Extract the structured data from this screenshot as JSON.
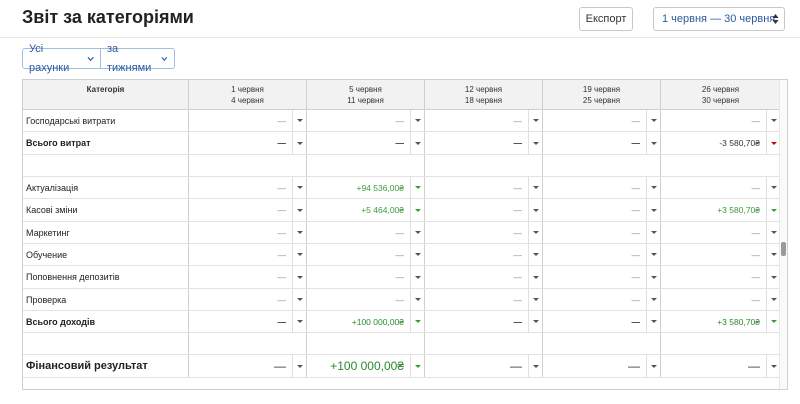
{
  "header": {
    "title": "Звіт за категоріями",
    "export_label": "Експорт",
    "date_range": "1 червня — 30 червня"
  },
  "filters": {
    "accounts": "Усі рахунки",
    "period": "за тижнями"
  },
  "table": {
    "category_header": "Категорія",
    "columns": [
      {
        "line1": "1 червня",
        "line2": "4 червня"
      },
      {
        "line1": "5 червня",
        "line2": "11 червня"
      },
      {
        "line1": "12 червня",
        "line2": "18 червня"
      },
      {
        "line1": "19 червня",
        "line2": "25 червня"
      },
      {
        "line1": "26 червня",
        "line2": "30 червня"
      }
    ],
    "rows": [
      {
        "label": "Господарські витрати",
        "style": "normal",
        "values": [
          "—",
          "—",
          "—",
          "—",
          "—"
        ],
        "tones": [
          "",
          "",
          "",
          "",
          ""
        ]
      },
      {
        "label": "Всього витрат",
        "style": "bold",
        "values": [
          "—",
          "—",
          "—",
          "—",
          "-3 580,70₴"
        ],
        "tones": [
          "",
          "",
          "",
          "",
          "neg"
        ]
      },
      {
        "label": "",
        "style": "empty",
        "values": [
          "",
          "",
          "",
          "",
          ""
        ],
        "tones": [
          "",
          "",
          "",
          "",
          ""
        ]
      },
      {
        "label": "Актуалізація",
        "style": "normal",
        "values": [
          "—",
          "+94 536,00₴",
          "—",
          "—",
          "—"
        ],
        "tones": [
          "",
          "pos",
          "",
          "",
          ""
        ]
      },
      {
        "label": "Касові зміни",
        "style": "normal",
        "values": [
          "—",
          "+5 464,00₴",
          "—",
          "—",
          "+3 580,70₴"
        ],
        "tones": [
          "",
          "pos",
          "",
          "",
          "pos"
        ]
      },
      {
        "label": "Маркетинг",
        "style": "normal",
        "values": [
          "—",
          "—",
          "—",
          "—",
          "—"
        ],
        "tones": [
          "",
          "",
          "",
          "",
          ""
        ]
      },
      {
        "label": "Обучение",
        "style": "normal",
        "values": [
          "—",
          "—",
          "—",
          "—",
          "—"
        ],
        "tones": [
          "",
          "",
          "",
          "",
          ""
        ]
      },
      {
        "label": "Поповнення депозитів",
        "style": "normal",
        "values": [
          "—",
          "—",
          "—",
          "—",
          "—"
        ],
        "tones": [
          "",
          "",
          "",
          "",
          ""
        ]
      },
      {
        "label": "Проверка",
        "style": "normal",
        "values": [
          "—",
          "—",
          "—",
          "—",
          "—"
        ],
        "tones": [
          "",
          "",
          "",
          "",
          ""
        ]
      },
      {
        "label": "Всього доходів",
        "style": "bold",
        "values": [
          "—",
          "+100 000,00₴",
          "—",
          "—",
          "+3 580,70₴"
        ],
        "tones": [
          "",
          "pos",
          "",
          "",
          "pos"
        ]
      },
      {
        "label": "",
        "style": "empty",
        "values": [
          "",
          "",
          "",
          "",
          ""
        ],
        "tones": [
          "",
          "",
          "",
          "",
          ""
        ]
      },
      {
        "label": "Фінансовий результат",
        "style": "big",
        "values": [
          "—",
          "+100 000,00₴",
          "—",
          "—",
          "—"
        ],
        "tones": [
          "",
          "pos",
          "",
          "",
          ""
        ]
      }
    ]
  },
  "colors": {
    "positive": "#3a9a3a",
    "negative": "#b01010",
    "link": "#2a5a9c"
  }
}
